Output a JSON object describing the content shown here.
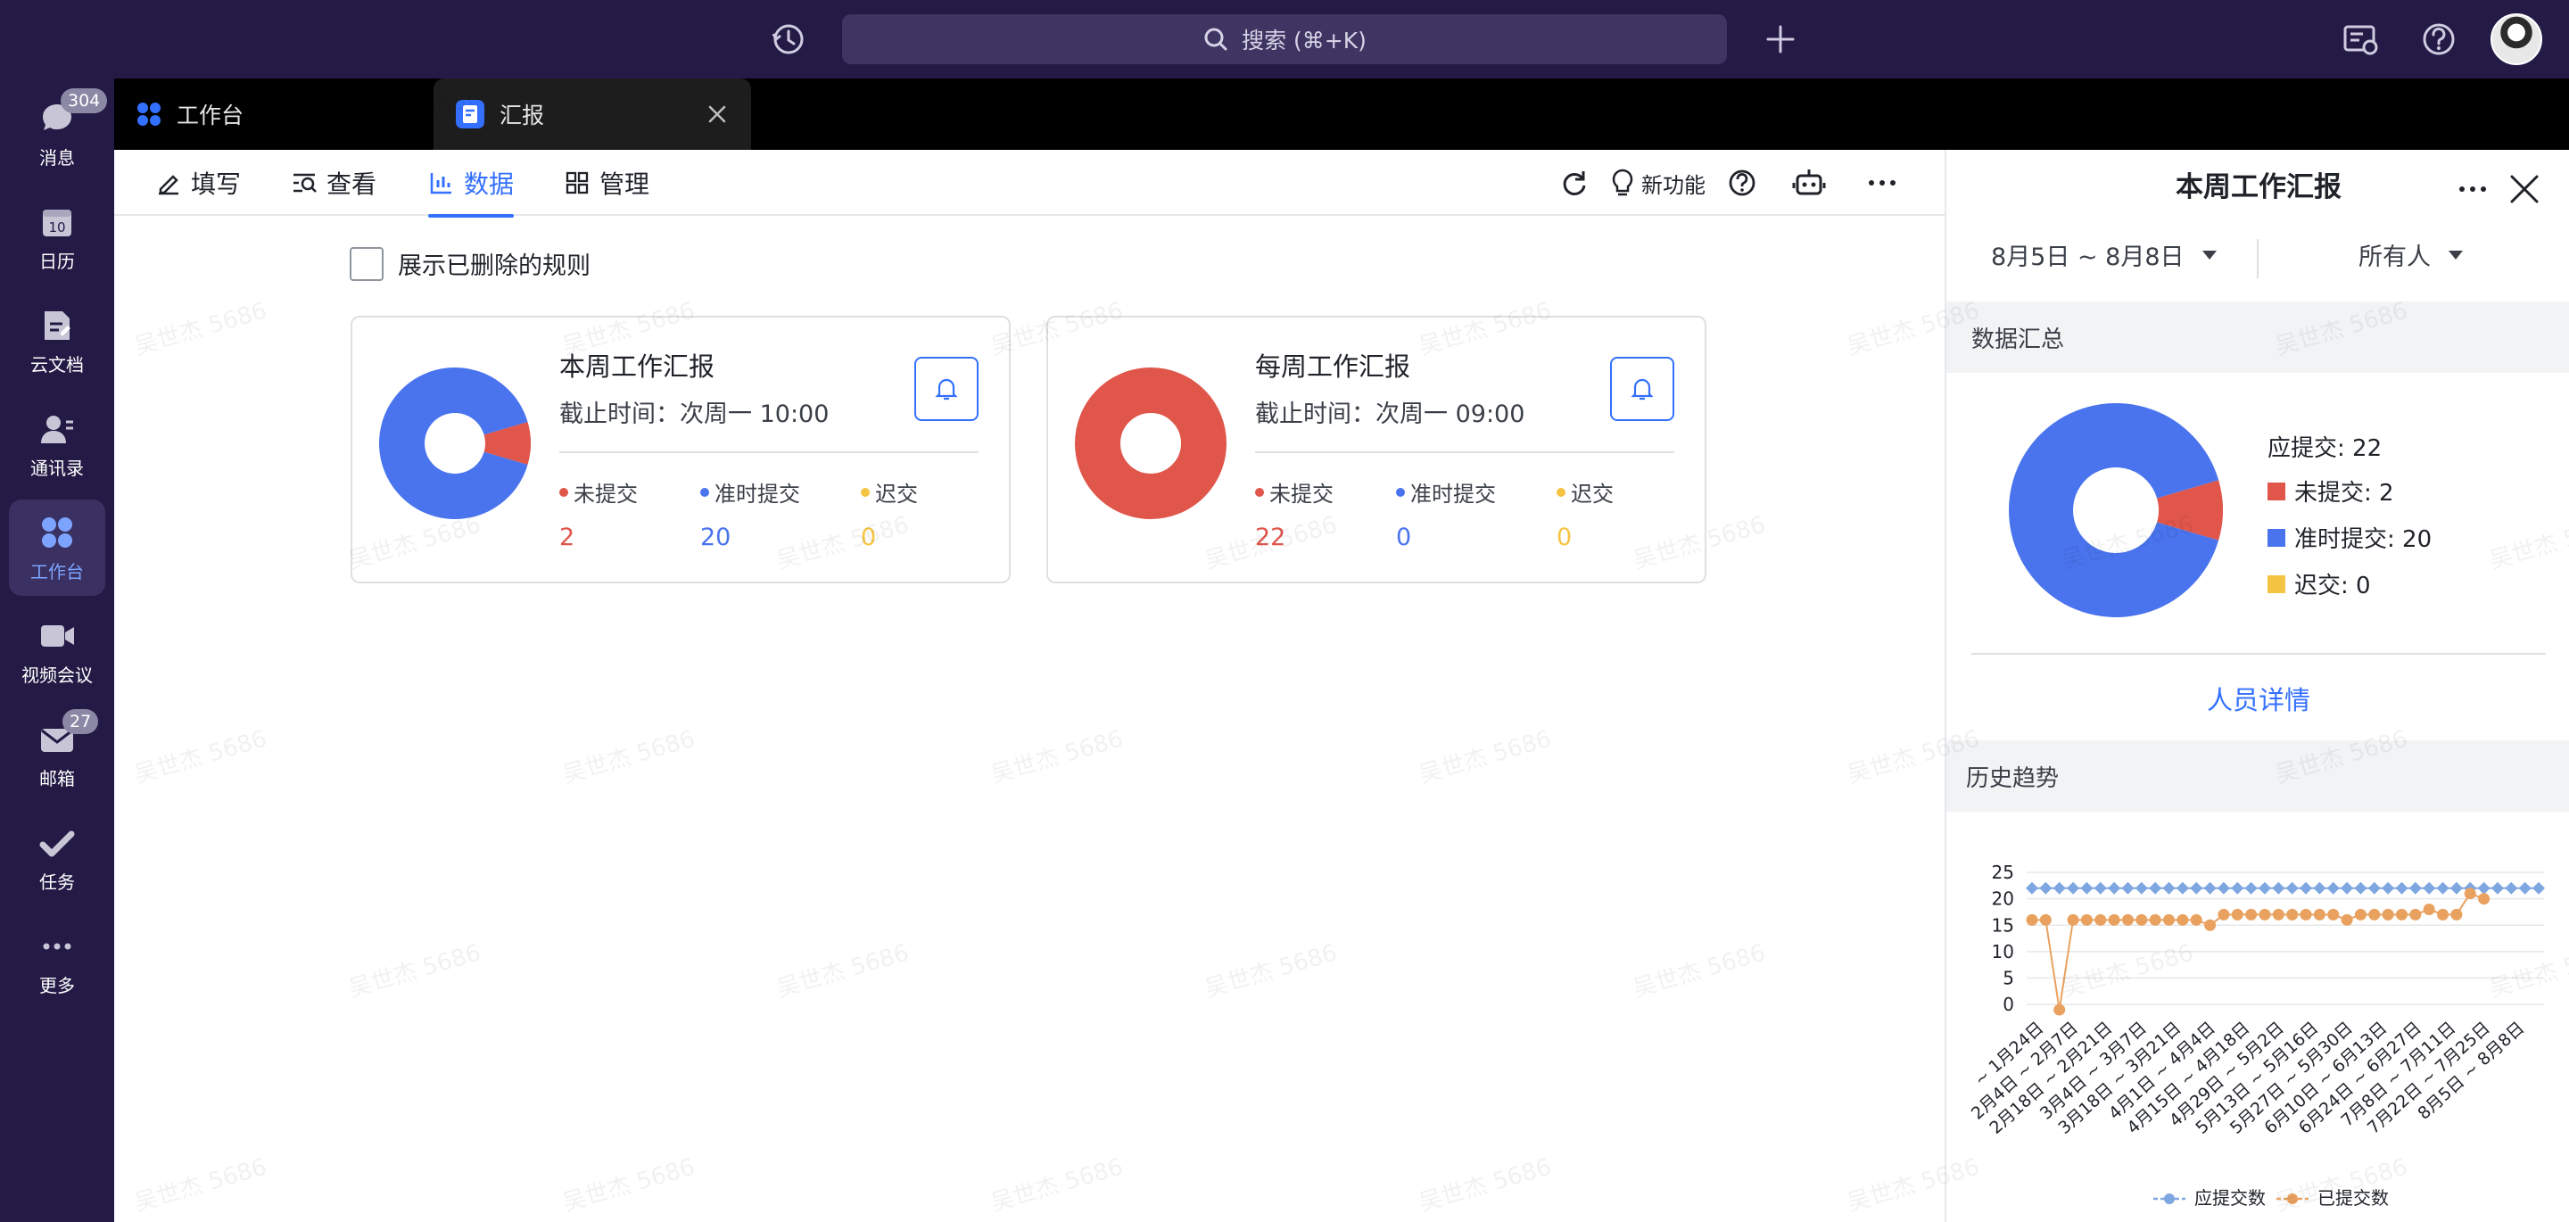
{
  "topbar": {
    "search_placeholder": "搜索 (⌘+K)"
  },
  "nav": {
    "items": [
      {
        "label": "消息",
        "badge": "304",
        "icon": "message-icon"
      },
      {
        "label": "日历",
        "icon": "calendar-icon",
        "calendar_day": "10"
      },
      {
        "label": "云文档",
        "icon": "document-icon"
      },
      {
        "label": "通讯录",
        "icon": "contacts-icon"
      },
      {
        "label": "工作台",
        "icon": "workspace-icon",
        "active": true
      },
      {
        "label": "视频会议",
        "icon": "video-icon"
      },
      {
        "label": "邮箱",
        "badge": "27",
        "icon": "mail-icon"
      },
      {
        "label": "任务",
        "icon": "task-icon"
      },
      {
        "label": "更多",
        "icon": "more-icon"
      }
    ]
  },
  "tabs": [
    {
      "label": "工作台",
      "icon": "workspace-icon"
    },
    {
      "label": "汇报",
      "icon": "report-icon",
      "active": true
    }
  ],
  "subnav": {
    "items": [
      {
        "label": "填写",
        "icon": "edit-icon"
      },
      {
        "label": "查看",
        "icon": "view-icon"
      },
      {
        "label": "数据",
        "icon": "bar-chart-icon",
        "active": true
      },
      {
        "label": "管理",
        "icon": "grid-icon"
      }
    ],
    "new_feature_label": "新功能"
  },
  "main": {
    "show_deleted_label": "展示已删除的规则",
    "cards": [
      {
        "title": "本周工作汇报",
        "deadline": "截止时间：次周一 10:00",
        "stats": [
          {
            "label": "未提交",
            "value": "2",
            "color": "#e0564b"
          },
          {
            "label": "准时提交",
            "value": "20",
            "color": "#4a74ee"
          },
          {
            "label": "迟交",
            "value": "0",
            "color": "#f6c443"
          }
        ]
      },
      {
        "title": "每周工作汇报",
        "deadline": "截止时间：次周一 09:00",
        "stats": [
          {
            "label": "未提交",
            "value": "22",
            "color": "#e0564b"
          },
          {
            "label": "准时提交",
            "value": "0",
            "color": "#4a74ee"
          },
          {
            "label": "迟交",
            "value": "0",
            "color": "#f6c443"
          }
        ]
      }
    ]
  },
  "panel": {
    "title": "本周工作汇报",
    "date_filter": "8月5日 ~ 8月8日",
    "people_filter": "所有人",
    "summary_label": "数据汇总",
    "legend": [
      {
        "label": "应提交: 22"
      },
      {
        "label": "未提交: 2",
        "color": "#e0564b"
      },
      {
        "label": "准时提交: 20",
        "color": "#4a74ee"
      },
      {
        "label": "迟交: 0",
        "color": "#f6c443"
      }
    ],
    "details_link": "人员详情",
    "history_label": "历史趋势"
  },
  "watermark_text": "吴世杰 5686",
  "chart_data": [
    {
      "type": "pie",
      "categories": [
        "未提交",
        "准时提交",
        "迟交"
      ],
      "values": [
        2,
        20,
        0
      ],
      "colors": [
        "#e0564b",
        "#4a74ee",
        "#f6c443"
      ]
    },
    {
      "type": "pie",
      "categories": [
        "未提交",
        "准时提交",
        "迟交"
      ],
      "values": [
        22,
        0,
        0
      ],
      "colors": [
        "#e0564b",
        "#4a74ee",
        "#f6c443"
      ]
    },
    {
      "type": "pie",
      "categories": [
        "未提交",
        "准时提交",
        "迟交"
      ],
      "values": [
        2,
        20,
        0
      ],
      "colors": [
        "#e0564b",
        "#4a74ee",
        "#f6c443"
      ]
    },
    {
      "type": "line",
      "x": [
        "1月24日",
        "",
        "2月4日 ~ 2月7日",
        "",
        "2月18日 ~ 2月21日",
        "",
        "3月4日 ~ 3月7日",
        "",
        "3月18日 ~ 3月21日",
        "",
        "4月1日 ~ 4月4日",
        "",
        "4月15日 ~ 4月18日",
        "",
        "4月29日 ~ 5月2日",
        "",
        "5月13日 ~ 5月16日",
        "",
        "5月27日 ~ 5月30日",
        "",
        "6月10日 ~ 6月13日",
        "",
        "6月24日 ~ 6月27日",
        "",
        "7月8日 ~ 7月11日",
        "",
        "7月22日 ~ 7月25日",
        "",
        "8月5日 ~ 8月8日",
        ""
      ],
      "x_tick_labels_prefix": "~ 1月24日",
      "series": [
        {
          "name": "应提交数",
          "color": "#7ea6e0",
          "marker": "diamond",
          "values": [
            22,
            22,
            22,
            22,
            22,
            22,
            22,
            22,
            22,
            22,
            22,
            22,
            22,
            22,
            22,
            22,
            22,
            22,
            22,
            22,
            22,
            22,
            22,
            22,
            22,
            22,
            22,
            22,
            22,
            22,
            22,
            22,
            22,
            22,
            22,
            22,
            22,
            22
          ]
        },
        {
          "name": "已提交数",
          "color": "#e9a15f",
          "marker": "circle",
          "values": [
            16,
            16,
            -1,
            16,
            16,
            16,
            16,
            16,
            16,
            16,
            16,
            16,
            16,
            15,
            17,
            17,
            17,
            17,
            17,
            17,
            17,
            17,
            17,
            16,
            17,
            17,
            17,
            17,
            17,
            18,
            17,
            17,
            21,
            20
          ]
        }
      ],
      "yticks": [
        0,
        5,
        10,
        15,
        20,
        25
      ],
      "ylim": [
        -2,
        25
      ]
    }
  ]
}
